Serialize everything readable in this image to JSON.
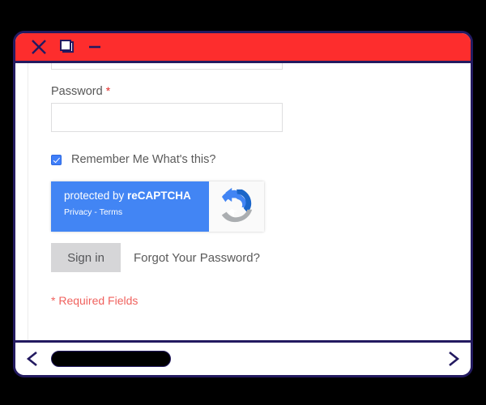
{
  "window": {
    "titlebar": {
      "close_icon": "close-x-icon",
      "restore_icon": "restore-window-icon",
      "minimize_icon": "minimize-icon",
      "background_color": "#fd2d2d",
      "border_color": "#231a60"
    }
  },
  "form": {
    "password_label": "Password",
    "required_marker": "*",
    "password_value": "",
    "password_placeholder": "",
    "remember_me_label": "Remember Me What's this?",
    "remember_me_checked": true,
    "signin_label": "Sign in",
    "forgot_password_label": "Forgot Your Password?",
    "required_fields_note": "* Required Fields",
    "required_note_color": "#f0625e"
  },
  "recaptcha": {
    "title_prefix": "protected by ",
    "title_brand": "reCAPTCHA",
    "links": "Privacy - Terms",
    "logo_icon": "recaptcha-logo-icon",
    "panel_color": "#4285f4"
  },
  "scrollbar": {
    "left_arrow": "<",
    "right_arrow": ">",
    "thumb_color": "#000000"
  }
}
